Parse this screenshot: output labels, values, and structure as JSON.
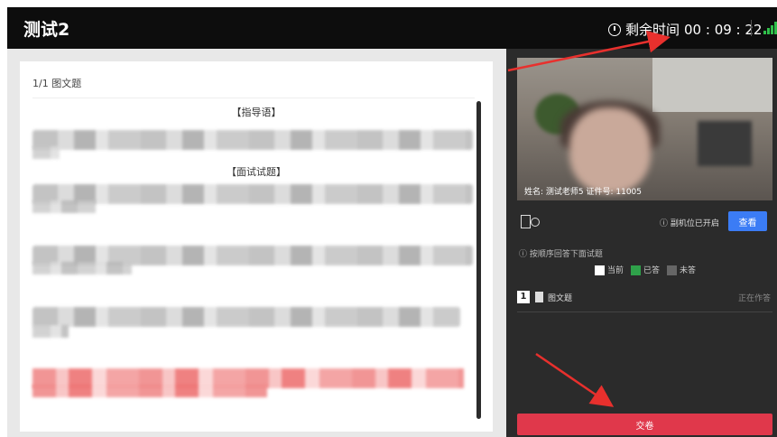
{
  "app": {
    "title": "测试2",
    "timer_label": "剩余时间",
    "timer_value": "00 : 09 : 22"
  },
  "exam": {
    "question_counter": "1/1 图文题",
    "instruction_heading": "【指导语】",
    "question_heading": "【面试试题】"
  },
  "candidate": {
    "caption": "姓名: 测试老师5   证件号: 11005"
  },
  "controls": {
    "camera_status": "副机位已开启",
    "view_button": "查看"
  },
  "answer_sheet": {
    "hint": "按顺序回答下面试题",
    "legend": [
      {
        "label": "当前",
        "color": "#ffffff"
      },
      {
        "label": "已答",
        "color": "#2fa14a"
      },
      {
        "label": "未答",
        "color": "#666666"
      }
    ],
    "questions": [
      {
        "index": "1",
        "type": "图文题",
        "state": "正在作答"
      }
    ]
  },
  "actions": {
    "submit_label": "交卷"
  },
  "colors": {
    "accent_blue": "#3b7cf5",
    "submit_red": "#e0384b",
    "signal_green": "#2fbf4a",
    "annotation_red": "#e8302d"
  }
}
